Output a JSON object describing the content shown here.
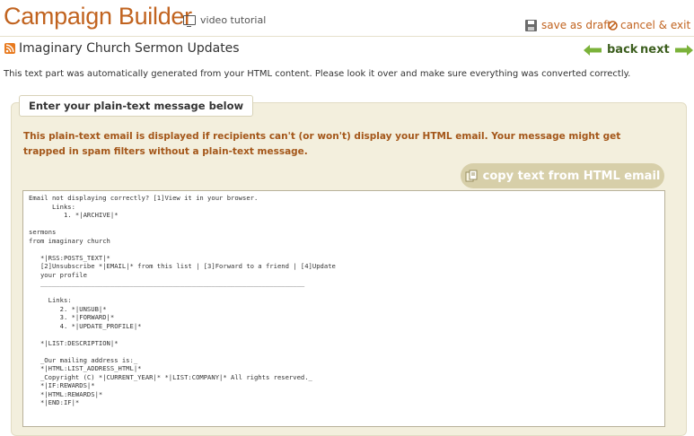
{
  "header": {
    "title": "Campaign Builder",
    "video_label": "video tutorial",
    "save_label": "save as draft",
    "cancel_label": "cancel & exit"
  },
  "campaign": {
    "name": "Imaginary Church Sermon Updates",
    "back_label": "back",
    "next_label": "next"
  },
  "info": "This text part was automatically generated from your HTML content. Please look it over and make sure everything was converted correctly.",
  "panel": {
    "tab_label": "Enter your plain-text message below",
    "warning": "This plain-text email is displayed if recipients can't (or won't) display your HTML email. Your message might get trapped in spam filters without a plain-text message.",
    "copy_button_label": "copy text from HTML email",
    "message_text": "Email not displaying correctly? [1]View it in your browser.\n      Links:\n         1. *|ARCHIVE|*\n\nsermons\nfrom imaginary church\n\n   *|RSS:POSTS_TEXT|*\n   [2]Unsubscribe *|EMAIL|* from this list | [3]Forward to a friend | [4]Update\n   your profile\n   ____________________________________________________________________\n\n     Links:\n        2. *|UNSUB|*\n        3. *|FORWARD|*\n        4. *|UPDATE_PROFILE|*\n\n   *|LIST:DESCRIPTION|*\n\n   _Our mailing address is:_\n   *|HTML:LIST_ADDRESS_HTML|*\n   _Copyright (C) *|CURRENT_YEAR|* *|LIST:COMPANY|* All rights reserved._\n   *|IF:REWARDS|*\n   *|HTML:REWARDS|*\n   *|END:IF|*"
  },
  "colors": {
    "brand": "#c1631f",
    "nav_green": "#3d5f1f",
    "panel_bg": "#f3efdd",
    "button_bg": "#d7cfa9",
    "warning_text": "#a4571a"
  }
}
